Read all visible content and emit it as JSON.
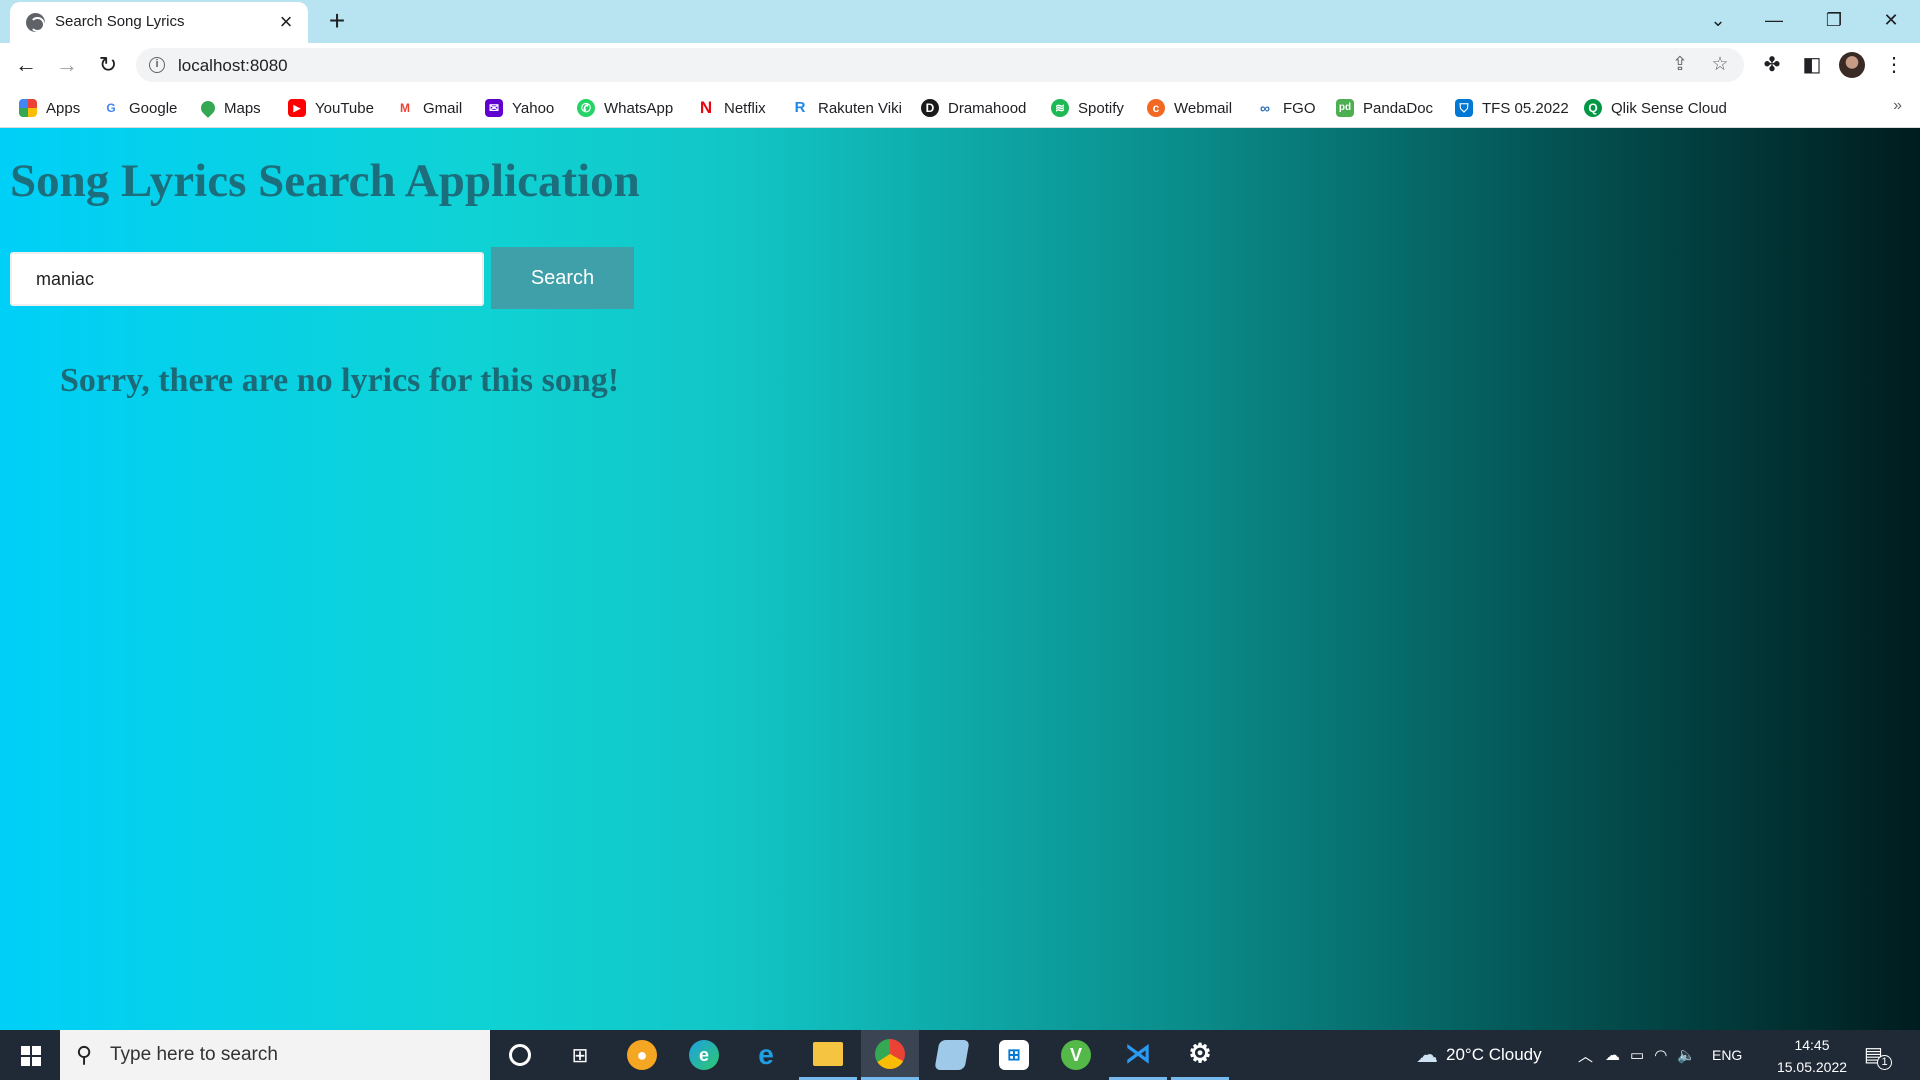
{
  "browser": {
    "tab_title": "Search Song Lyrics",
    "url": "localhost:8080",
    "bookmarks": [
      {
        "label": "Apps",
        "color": "#ea4335"
      },
      {
        "label": "Google",
        "color": "#4285f4"
      },
      {
        "label": "Maps",
        "color": "#34a853"
      },
      {
        "label": "YouTube",
        "color": "#ff0000"
      },
      {
        "label": "Gmail",
        "color": "#ea4335"
      },
      {
        "label": "Yahoo",
        "color": "#6001d2"
      },
      {
        "label": "WhatsApp",
        "color": "#25d366"
      },
      {
        "label": "Netflix",
        "color": "#e50914"
      },
      {
        "label": "Rakuten Viki",
        "color": "#1e88e5"
      },
      {
        "label": "Dramahood",
        "color": "#1a1a1a"
      },
      {
        "label": "Spotify",
        "color": "#1db954"
      },
      {
        "label": "Webmail",
        "color": "#f26722"
      },
      {
        "label": "FGO",
        "color": "#2d6fb7"
      },
      {
        "label": "PandaDoc",
        "color": "#4caf50"
      },
      {
        "label": "TFS 05.2022",
        "color": "#0078d4"
      },
      {
        "label": "Qlik Sense Cloud",
        "color": "#009845"
      }
    ]
  },
  "app": {
    "title": "Song Lyrics Search Application",
    "search_value": "maniac",
    "search_button": "Search",
    "message": "Sorry, there are no lyrics for this song!"
  },
  "taskbar": {
    "search_placeholder": "Type here to search",
    "weather": "20°C Cloudy",
    "language": "ENG",
    "time": "14:45",
    "date": "15.05.2022",
    "notification_count": "1"
  }
}
